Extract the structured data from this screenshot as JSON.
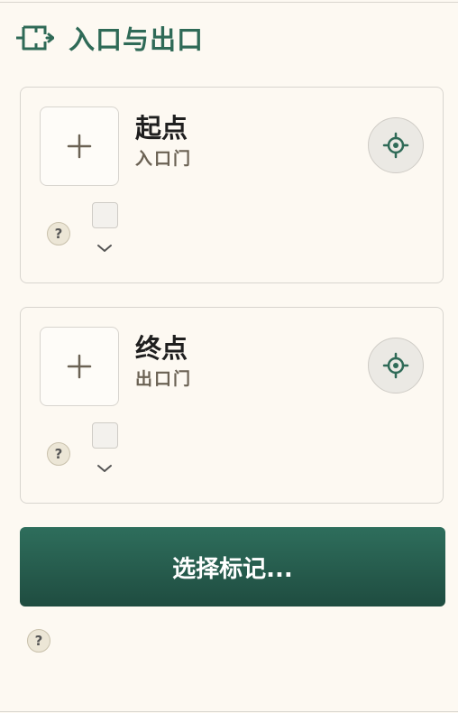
{
  "header": {
    "title": "入口与出口",
    "icon": "entrance-exit-icon"
  },
  "start": {
    "title": "起点",
    "subtitle": "入口门",
    "add_icon": "plus-icon",
    "locate_icon": "crosshair-icon",
    "help": "?"
  },
  "end": {
    "title": "终点",
    "subtitle": "出口门",
    "add_icon": "plus-icon",
    "locate_icon": "crosshair-icon",
    "help": "?"
  },
  "select_button": {
    "label": "选择标记..."
  },
  "footer": {
    "help": "?"
  },
  "colors": {
    "accent": "#2f6a57",
    "button_top": "#2e6e5c",
    "button_bottom": "#1f4c40",
    "background": "#fdf9f2"
  }
}
